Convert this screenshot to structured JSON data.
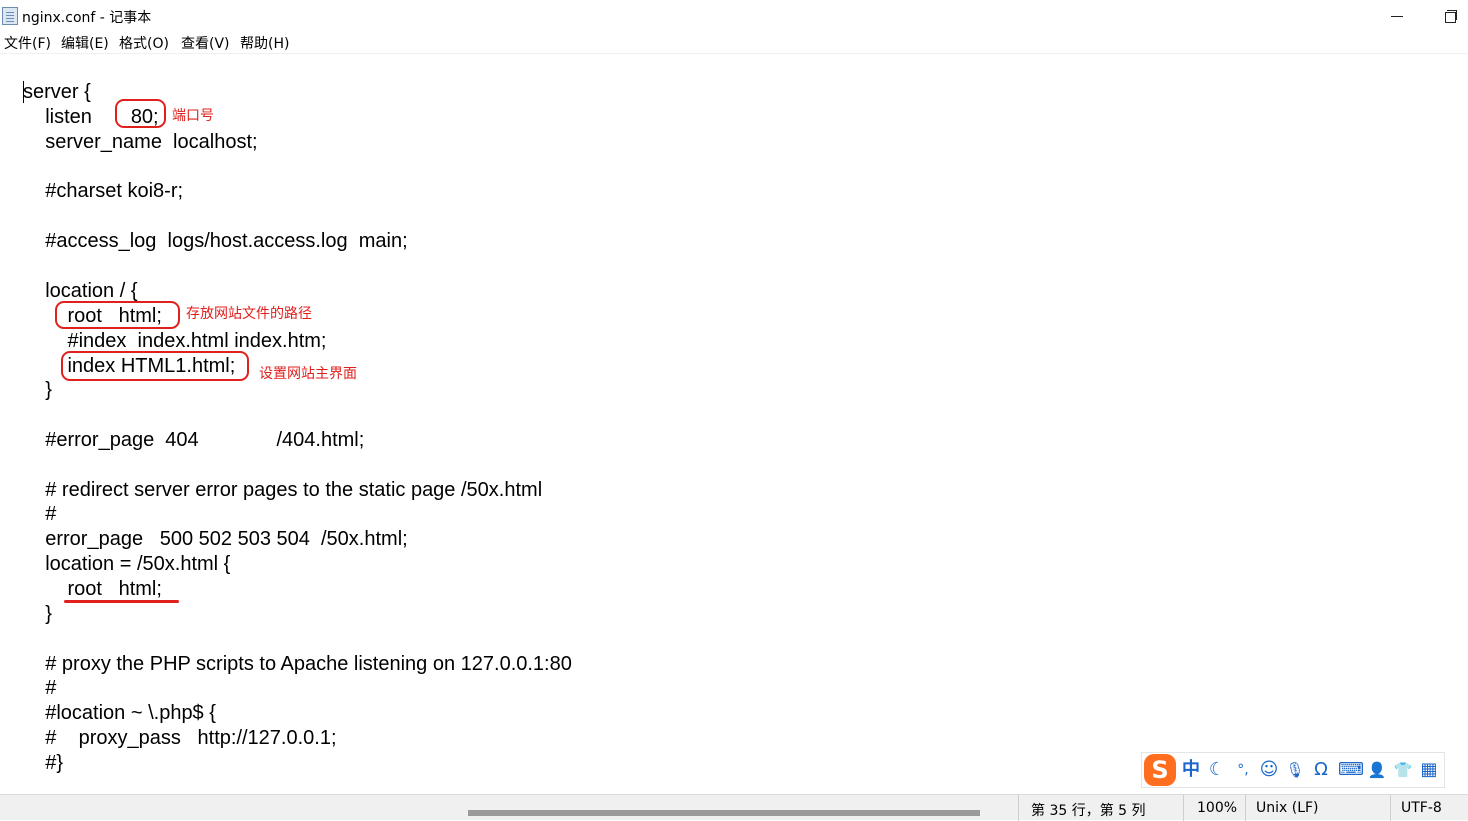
{
  "window": {
    "title": "nginx.conf - 记事本",
    "app_icon": "notepad-icon",
    "controls": {
      "minimize_icon": "minimize-icon",
      "restore_icon": "restore-icon"
    }
  },
  "menu": [
    "文件(F)",
    "编辑(E)",
    "格式(O)",
    "查看(V)",
    "帮助(H)"
  ],
  "code_lines": [
    "server {",
    "    listen       80;",
    "    server_name  localhost;",
    "",
    "    #charset koi8-r;",
    "",
    "    #access_log  logs/host.access.log  main;",
    "",
    "    location / {",
    "        root   html;",
    "        #index  index.html index.htm;",
    "        index HTML1.html;",
    "    }",
    "",
    "    #error_page  404              /404.html;",
    "",
    "    # redirect server error pages to the static page /50x.html",
    "    #",
    "    error_page   500 502 503 504  /50x.html;",
    "    location = /50x.html {",
    "        root   html;",
    "    }",
    "",
    "    # proxy the PHP scripts to Apache listening on 127.0.0.1:80",
    "    #",
    "    #location ~ \\.php$ {",
    "    #    proxy_pass   http://127.0.0.1;",
    "    #}"
  ],
  "annotations": {
    "port_label": "端口号",
    "root_label": "存放网站文件的路径",
    "index_label": "设置网站主界面",
    "color": "#e0201d"
  },
  "ime_toolbar": {
    "logo_text": "S",
    "items": [
      {
        "icon": "chinese-mode-icon",
        "glyph": "中"
      },
      {
        "icon": "moon-icon",
        "glyph": "☾"
      },
      {
        "icon": "punctuation-icon",
        "glyph": "°,"
      },
      {
        "icon": "emoji-icon",
        "glyph": "☺"
      },
      {
        "icon": "microphone-icon",
        "glyph": "🎙"
      },
      {
        "icon": "symbol-omega-icon",
        "glyph": "Ω"
      },
      {
        "icon": "keyboard-icon",
        "glyph": "⌨"
      },
      {
        "icon": "user-icon",
        "glyph": "👤"
      },
      {
        "icon": "skin-shirt-icon",
        "glyph": "👕"
      },
      {
        "icon": "apps-grid-icon",
        "glyph": "▦"
      }
    ],
    "accent_color": "#1a66c9",
    "logo_color": "#ff6d1f"
  },
  "statusbar": {
    "position": "第 35 行，第 5 列",
    "zoom": "100%",
    "line_ending": "Unix (LF)",
    "encoding": "UTF-8"
  }
}
